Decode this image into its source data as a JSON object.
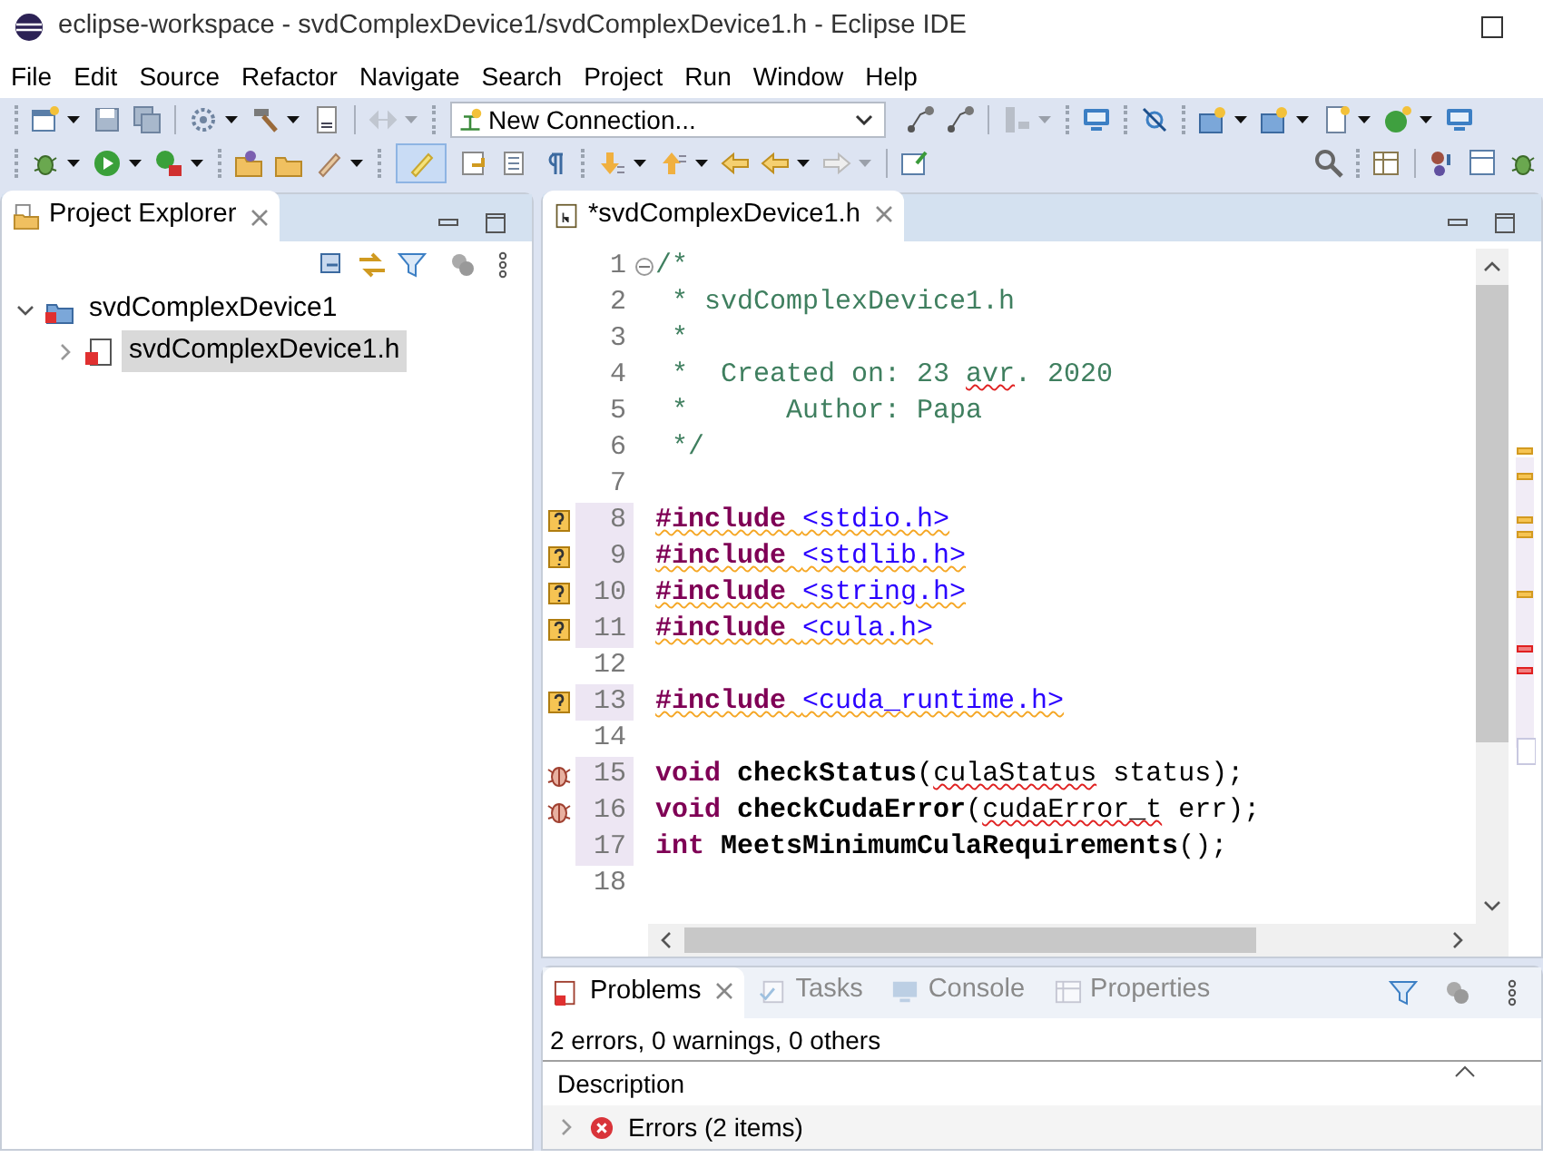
{
  "window": {
    "title": "eclipse-workspace - svdComplexDevice1/svdComplexDevice1.h - Eclipse IDE"
  },
  "menu": [
    "File",
    "Edit",
    "Source",
    "Refactor",
    "Navigate",
    "Search",
    "Project",
    "Run",
    "Window",
    "Help"
  ],
  "toolbar": {
    "connection_combo": "New Connection..."
  },
  "project_explorer": {
    "title": "Project Explorer",
    "tree": [
      {
        "label": "svdComplexDevice1",
        "kind": "project",
        "expanded": true,
        "selected": false,
        "children": [
          {
            "label": "svdComplexDevice1.h",
            "kind": "header",
            "expanded": false,
            "selected": true
          }
        ]
      }
    ]
  },
  "editor": {
    "tab": "*svdComplexDevice1.h",
    "lines": [
      {
        "number": "1",
        "has_warning": false,
        "has_error": false,
        "changed": false,
        "fold": true,
        "tokens": [
          {
            "kind": "comment",
            "text": "/*"
          }
        ]
      },
      {
        "number": "2",
        "has_warning": false,
        "has_error": false,
        "changed": false,
        "tokens": [
          {
            "kind": "comment",
            "text": " * svdComplexDevice1.h"
          }
        ]
      },
      {
        "number": "3",
        "has_warning": false,
        "has_error": false,
        "changed": false,
        "tokens": [
          {
            "kind": "comment",
            "text": " *"
          }
        ]
      },
      {
        "number": "4",
        "has_warning": false,
        "has_error": false,
        "changed": false,
        "tokens": [
          {
            "kind": "comment",
            "text": " *  Created on: 23 "
          },
          {
            "kind": "comment",
            "text": "avr",
            "error_underline": true
          },
          {
            "kind": "comment",
            "text": ". 2020"
          }
        ]
      },
      {
        "number": "5",
        "has_warning": false,
        "has_error": false,
        "changed": false,
        "tokens": [
          {
            "kind": "comment",
            "text": " *      Author: Papa"
          }
        ]
      },
      {
        "number": "6",
        "has_warning": false,
        "has_error": false,
        "changed": false,
        "tokens": [
          {
            "kind": "comment",
            "text": " */"
          }
        ]
      },
      {
        "number": "7",
        "has_warning": false,
        "has_error": false,
        "changed": false
      },
      {
        "number": "8",
        "has_warning": true,
        "has_error": false,
        "changed": true,
        "tokens": [
          {
            "kind": "directive",
            "text": "#include ",
            "warning_underline": true
          },
          {
            "kind": "header",
            "text": "<stdio.h>",
            "warning_underline": true
          }
        ]
      },
      {
        "number": "9",
        "has_warning": true,
        "has_error": false,
        "changed": true,
        "tokens": [
          {
            "kind": "directive",
            "text": "#include ",
            "warning_underline": true
          },
          {
            "kind": "header",
            "text": "<stdlib.h>",
            "warning_underline": true
          }
        ]
      },
      {
        "number": "10",
        "has_warning": true,
        "has_error": false,
        "changed": true,
        "tokens": [
          {
            "kind": "directive",
            "text": "#include ",
            "warning_underline": true
          },
          {
            "kind": "header",
            "text": "<string.h>",
            "warning_underline": true
          }
        ]
      },
      {
        "number": "11",
        "has_warning": true,
        "has_error": false,
        "changed": true,
        "tokens": [
          {
            "kind": "directive",
            "text": "#include ",
            "warning_underline": true
          },
          {
            "kind": "header",
            "text": "<cula.h>",
            "warning_underline": true
          }
        ]
      },
      {
        "number": "12",
        "has_warning": false,
        "has_error": false,
        "changed": false
      },
      {
        "number": "13",
        "has_warning": true,
        "has_error": false,
        "changed": true,
        "tokens": [
          {
            "kind": "directive",
            "text": "#include ",
            "warning_underline": true
          },
          {
            "kind": "header",
            "text": "<cuda_runtime.h>",
            "warning_underline": true
          }
        ]
      },
      {
        "number": "14",
        "has_warning": false,
        "has_error": false,
        "changed": false
      },
      {
        "number": "15",
        "has_warning": false,
        "has_error": true,
        "changed": true,
        "tokens": [
          {
            "kind": "keyword",
            "text": "void "
          },
          {
            "kind": "function",
            "text": "checkStatus"
          },
          {
            "kind": "plain",
            "text": "("
          },
          {
            "kind": "plain",
            "text": "culaStatus",
            "error_underline": true
          },
          {
            "kind": "plain",
            "text": " status);"
          }
        ]
      },
      {
        "number": "16",
        "has_warning": false,
        "has_error": true,
        "changed": true,
        "tokens": [
          {
            "kind": "keyword",
            "text": "void "
          },
          {
            "kind": "function",
            "text": "checkCudaError"
          },
          {
            "kind": "plain",
            "text": "("
          },
          {
            "kind": "plain",
            "text": "cudaError_t",
            "error_underline": true
          },
          {
            "kind": "plain",
            "text": " err);"
          }
        ]
      },
      {
        "number": "17",
        "has_warning": false,
        "has_error": false,
        "changed": true,
        "tokens": [
          {
            "kind": "keyword",
            "text": "int "
          },
          {
            "kind": "function",
            "text": "MeetsMinimumCulaRequirements"
          },
          {
            "kind": "plain",
            "text": "();"
          }
        ]
      },
      {
        "number": "18",
        "has_warning": false,
        "has_error": false,
        "changed": false
      }
    ]
  },
  "bottom_panel": {
    "tabs": [
      {
        "label": "Problems",
        "kind": "problems",
        "selected": true
      },
      {
        "label": "Tasks",
        "kind": "tasks",
        "selected": false
      },
      {
        "label": "Console",
        "kind": "console",
        "selected": false
      },
      {
        "label": "Properties",
        "kind": "properties",
        "selected": false
      }
    ],
    "summary": "2 errors, 0 warnings, 0 others",
    "column": "Description",
    "rows": [
      {
        "label": "Errors (2 items)",
        "kind": "error",
        "expanded": false
      }
    ]
  }
}
